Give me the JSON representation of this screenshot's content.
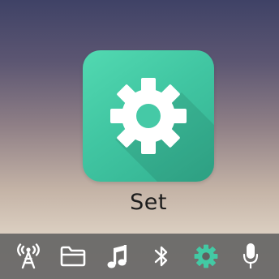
{
  "app": {
    "label": "Set",
    "icon": "gear-icon",
    "tile_color": "#43c9a4"
  },
  "dock": {
    "items": [
      {
        "icon": "antenna-icon"
      },
      {
        "icon": "folder-icon"
      },
      {
        "icon": "music-icon"
      },
      {
        "icon": "bluetooth-icon"
      },
      {
        "icon": "gear-icon",
        "active": true,
        "color": "#43c9a4"
      },
      {
        "icon": "microphone-icon"
      }
    ]
  }
}
